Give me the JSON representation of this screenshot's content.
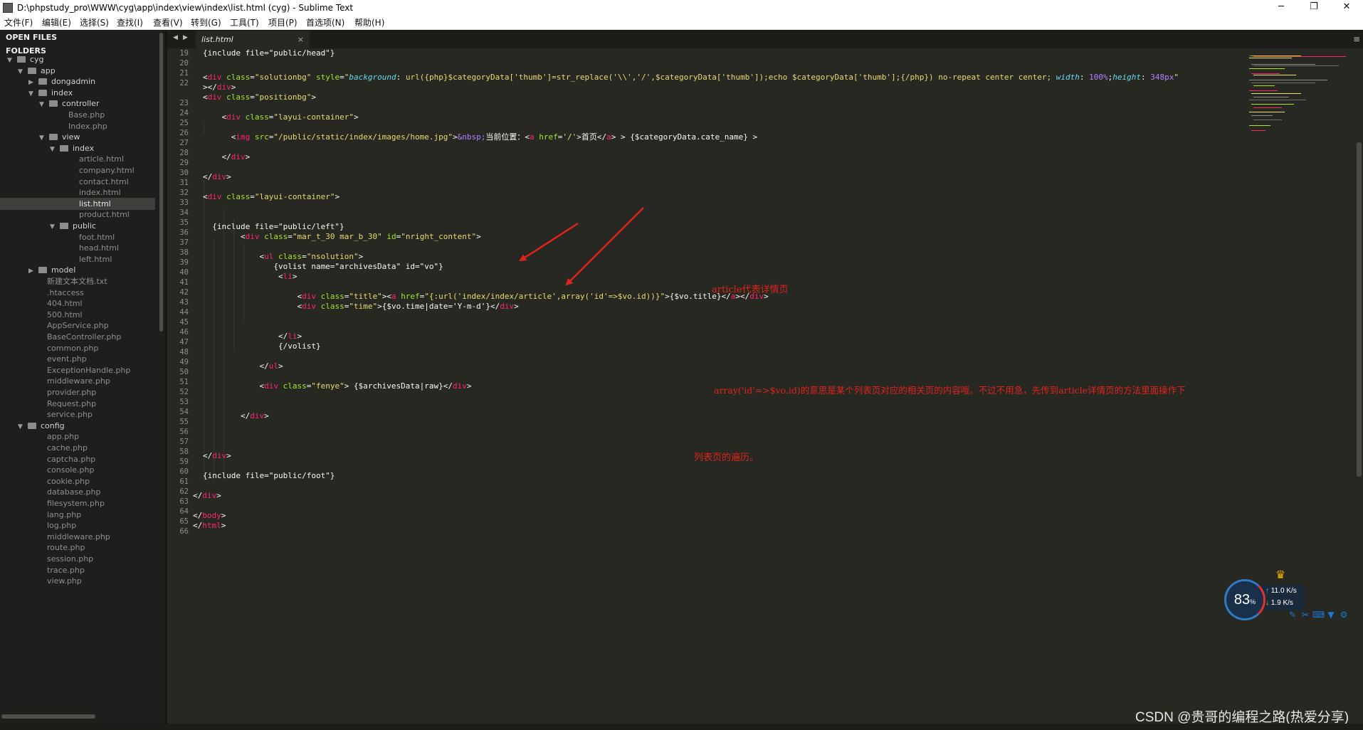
{
  "window": {
    "title": "D:\\phpstudy_pro\\WWW\\cyg\\app\\index\\view\\index\\list.html (cyg) - Sublime Text",
    "minimize": "─",
    "restore": "❐",
    "close": "✕"
  },
  "menu": [
    "文件(F)",
    "编辑(E)",
    "选择(S)",
    "查找(I)",
    "查看(V)",
    "转到(G)",
    "工具(T)",
    "项目(P)",
    "首选项(N)",
    "帮助(H)"
  ],
  "sidebar": {
    "open_files": "OPEN FILES",
    "folders": "FOLDERS",
    "items": [
      {
        "label": "cyg",
        "kind": "folder",
        "expanded": true,
        "depth": 0
      },
      {
        "label": "app",
        "kind": "folder",
        "expanded": true,
        "depth": 1
      },
      {
        "label": "dongadmin",
        "kind": "folder",
        "expanded": false,
        "depth": 2
      },
      {
        "label": "index",
        "kind": "folder",
        "expanded": true,
        "depth": 2
      },
      {
        "label": "controller",
        "kind": "folder",
        "expanded": true,
        "depth": 3
      },
      {
        "label": "Base.php",
        "kind": "file",
        "depth": 4
      },
      {
        "label": "Index.php",
        "kind": "file",
        "depth": 4
      },
      {
        "label": "view",
        "kind": "folder",
        "expanded": true,
        "depth": 3
      },
      {
        "label": "index",
        "kind": "folder",
        "expanded": true,
        "depth": 4
      },
      {
        "label": "article.html",
        "kind": "file",
        "depth": 5
      },
      {
        "label": "company.html",
        "kind": "file",
        "depth": 5
      },
      {
        "label": "contact.html",
        "kind": "file",
        "depth": 5
      },
      {
        "label": "index.html",
        "kind": "file",
        "depth": 5
      },
      {
        "label": "list.html",
        "kind": "file",
        "depth": 5,
        "selected": true
      },
      {
        "label": "product.html",
        "kind": "file",
        "depth": 5
      },
      {
        "label": "public",
        "kind": "folder",
        "expanded": true,
        "depth": 4
      },
      {
        "label": "foot.html",
        "kind": "file",
        "depth": 5
      },
      {
        "label": "head.html",
        "kind": "file",
        "depth": 5
      },
      {
        "label": "left.html",
        "kind": "file",
        "depth": 5
      },
      {
        "label": "model",
        "kind": "folder",
        "expanded": false,
        "depth": 2
      },
      {
        "label": "新建文本文档.txt",
        "kind": "file",
        "depth": 2
      },
      {
        "label": ".htaccess",
        "kind": "file",
        "depth": 2
      },
      {
        "label": "404.html",
        "kind": "file",
        "depth": 2
      },
      {
        "label": "500.html",
        "kind": "file",
        "depth": 2
      },
      {
        "label": "AppService.php",
        "kind": "file",
        "depth": 2
      },
      {
        "label": "BaseController.php",
        "kind": "file",
        "depth": 2
      },
      {
        "label": "common.php",
        "kind": "file",
        "depth": 2
      },
      {
        "label": "event.php",
        "kind": "file",
        "depth": 2
      },
      {
        "label": "ExceptionHandle.php",
        "kind": "file",
        "depth": 2
      },
      {
        "label": "middleware.php",
        "kind": "file",
        "depth": 2
      },
      {
        "label": "provider.php",
        "kind": "file",
        "depth": 2
      },
      {
        "label": "Request.php",
        "kind": "file",
        "depth": 2
      },
      {
        "label": "service.php",
        "kind": "file",
        "depth": 2
      },
      {
        "label": "config",
        "kind": "folder",
        "expanded": true,
        "depth": 1
      },
      {
        "label": "app.php",
        "kind": "file",
        "depth": 2
      },
      {
        "label": "cache.php",
        "kind": "file",
        "depth": 2
      },
      {
        "label": "captcha.php",
        "kind": "file",
        "depth": 2
      },
      {
        "label": "console.php",
        "kind": "file",
        "depth": 2
      },
      {
        "label": "cookie.php",
        "kind": "file",
        "depth": 2
      },
      {
        "label": "database.php",
        "kind": "file",
        "depth": 2
      },
      {
        "label": "filesystem.php",
        "kind": "file",
        "depth": 2
      },
      {
        "label": "lang.php",
        "kind": "file",
        "depth": 2
      },
      {
        "label": "log.php",
        "kind": "file",
        "depth": 2
      },
      {
        "label": "middleware.php",
        "kind": "file",
        "depth": 2
      },
      {
        "label": "route.php",
        "kind": "file",
        "depth": 2
      },
      {
        "label": "session.php",
        "kind": "file",
        "depth": 2
      },
      {
        "label": "trace.php",
        "kind": "file",
        "depth": 2
      },
      {
        "label": "view.php",
        "kind": "file",
        "depth": 2
      }
    ]
  },
  "tabs": {
    "active": "list.html",
    "close": "×",
    "prev": "◀",
    "next": "▶",
    "menu": "≡"
  },
  "editor": {
    "line_numbers": [
      "19",
      "20",
      "21",
      "22",
      "",
      "23",
      "24",
      "25",
      "26",
      "27",
      "28",
      "29",
      "30",
      "31",
      "32",
      "33",
      "34",
      "35",
      "36",
      "37",
      "38",
      "39",
      "40",
      "41",
      "42",
      "43",
      "44",
      "45",
      "46",
      "47",
      "48",
      "49",
      "50",
      "51",
      "52",
      "53",
      "54",
      "55",
      "56",
      "57",
      "58",
      "59",
      "60",
      "61",
      "62",
      "63",
      "64",
      "65",
      "66"
    ]
  },
  "annotations": {
    "a1": "article代表详情页",
    "a2": "array('id'=>$vo.id)的意思是某个列表页对应的相关页的内容哦。不过不用急，先传到article详情页的方法里面操作下",
    "a3": "列表页的遍历。"
  },
  "net_widget": {
    "percent": "83",
    "percent_unit": "%",
    "upload": "11.0",
    "download": "1.9",
    "unit": "K/s",
    "up_arrow": "↑",
    "down_arrow": "↓"
  },
  "watermark": "CSDN @贵哥的编程之路(热爱分享)"
}
